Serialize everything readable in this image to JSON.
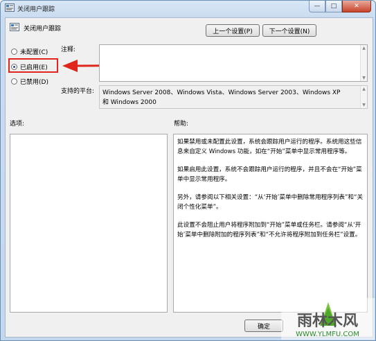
{
  "window": {
    "title": "关闭用户跟踪",
    "controls": {
      "minimize": "—",
      "maximize": "□",
      "close": "✕"
    }
  },
  "header": {
    "title": "关闭用户跟踪",
    "prev_button": "上一个设置(P)",
    "next_button": "下一个设置(N)"
  },
  "state": {
    "options": [
      {
        "label": "未配置(C)",
        "checked": false
      },
      {
        "label": "已启用(E)",
        "checked": true
      },
      {
        "label": "已禁用(D)",
        "checked": false
      }
    ]
  },
  "comment": {
    "label": "注释:",
    "value": ""
  },
  "platform": {
    "label": "支持的平台:",
    "value": "Windows Server 2008、Windows Vista、Windows Server 2003、Windows XP 和 Windows 2000"
  },
  "options_panel": {
    "label": "选项:"
  },
  "help_panel": {
    "label": "帮助:",
    "paragraphs": [
      "如果禁用或未配置此设置，系统会跟踪用户运行的程序。系统用这些信息来自定义 Windows 功能，如在“开始”菜单中显示常用程序等。",
      "如果启用此设置，系统不会跟踪用户运行的程序，并且不会在“开始”菜单中显示常用程序。",
      "另外，请参阅以下相关设置：“从‘开始’菜单中删除常用程序列表”和“关闭个性化菜单”。",
      "此设置不会阻止用户将程序附加到“开始”菜单或任务栏。请参阅“从‘开始’菜单中删除附加的程序列表”和“不允许将程序附加到任务栏”设置。"
    ]
  },
  "footer": {
    "ok_button": "确定"
  },
  "watermark": {
    "text": "雨林木风",
    "url": "WWW.YLMFU.COM"
  },
  "colors": {
    "highlight": "#e0251c",
    "accent": "#1a4fa0"
  }
}
